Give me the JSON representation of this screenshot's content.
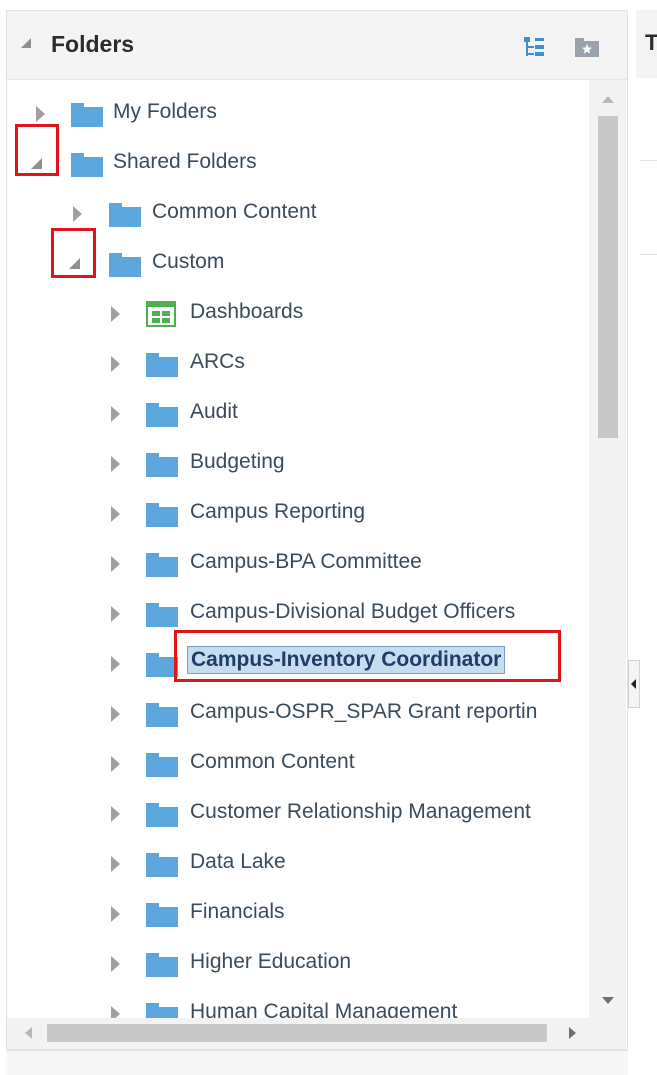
{
  "panel": {
    "title": "Folders",
    "right_partial_title": "T"
  },
  "tree": {
    "my_folders": "My Folders",
    "shared_folders": "Shared Folders",
    "common_content": "Common Content",
    "custom": "Custom",
    "children": [
      {
        "label": "Dashboards",
        "icon": "dashboard-folder-icon"
      },
      {
        "label": "ARCs",
        "icon": "folder-icon"
      },
      {
        "label": "Audit",
        "icon": "folder-icon"
      },
      {
        "label": "Budgeting",
        "icon": "folder-icon"
      },
      {
        "label": "Campus Reporting",
        "icon": "folder-icon"
      },
      {
        "label": "Campus-BPA Committee",
        "icon": "folder-icon"
      },
      {
        "label": "Campus-Divisional Budget Officers",
        "icon": "folder-icon"
      },
      {
        "label": "Campus-Inventory Coordinator",
        "icon": "folder-icon"
      },
      {
        "label": "Campus-OSPR_SPAR Grant reportin",
        "icon": "folder-icon"
      },
      {
        "label": "Common Content",
        "icon": "folder-icon"
      },
      {
        "label": "Customer Relationship Management",
        "icon": "folder-icon"
      },
      {
        "label": "Data Lake",
        "icon": "folder-icon"
      },
      {
        "label": "Financials",
        "icon": "folder-icon"
      },
      {
        "label": "Higher Education",
        "icon": "folder-icon"
      },
      {
        "label": "Human Capital Management",
        "icon": "folder-icon"
      }
    ]
  },
  "colors": {
    "folder": "#5aa6dd",
    "highlight": "#e0141b",
    "selection": "#c6dcf0"
  }
}
